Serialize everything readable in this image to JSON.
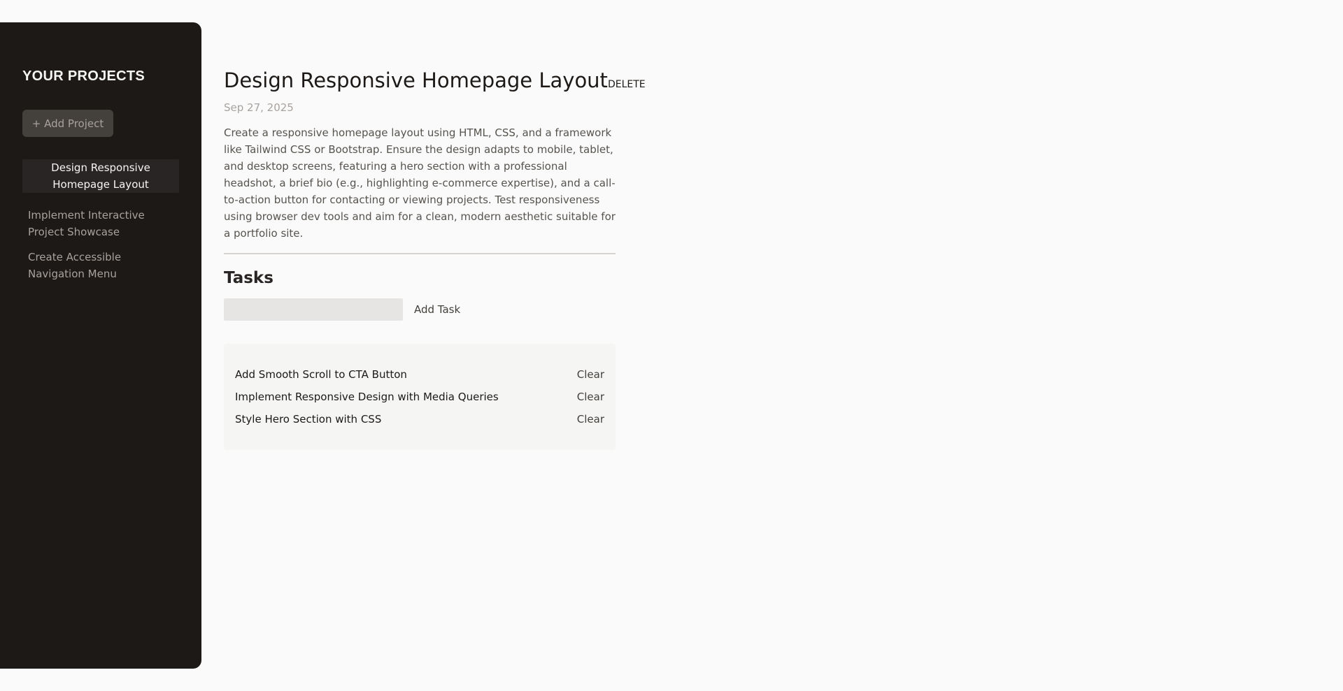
{
  "sidebar": {
    "title": "YOUR PROJECTS",
    "add_project_label": "+ Add Project",
    "projects": [
      {
        "label": "Design Responsive Homepage Layout",
        "active": true
      },
      {
        "label": "Implement Interactive Project Showcase",
        "active": false
      },
      {
        "label": "Create Accessible Navigation Menu",
        "active": false
      }
    ]
  },
  "project": {
    "title": "Design Responsive Homepage Layout",
    "delete_label": "DELETE",
    "date": "Sep 27, 2025",
    "description": "Create a responsive homepage layout using HTML, CSS, and a framework like Tailwind CSS or Bootstrap. Ensure the design adapts to mobile, tablet, and desktop screens, featuring a hero section with a professional headshot, a brief bio (e.g., highlighting e-commerce expertise), and a call-to-action button for contacting or viewing projects. Test responsiveness using browser dev tools and aim for a clean, modern aesthetic suitable for a portfolio site."
  },
  "tasks": {
    "title": "Tasks",
    "input_value": "",
    "add_task_label": "Add Task",
    "items": [
      {
        "text": "Add Smooth Scroll to CTA Button",
        "clear_label": "Clear"
      },
      {
        "text": "Implement Responsive Design with Media Queries",
        "clear_label": "Clear"
      },
      {
        "text": "Style Hero Section with CSS",
        "clear_label": "Clear"
      }
    ]
  },
  "colors": {
    "sidebar_bg": "#1c1917",
    "page_bg": "#fafafa",
    "accent_button": "#44403c"
  }
}
